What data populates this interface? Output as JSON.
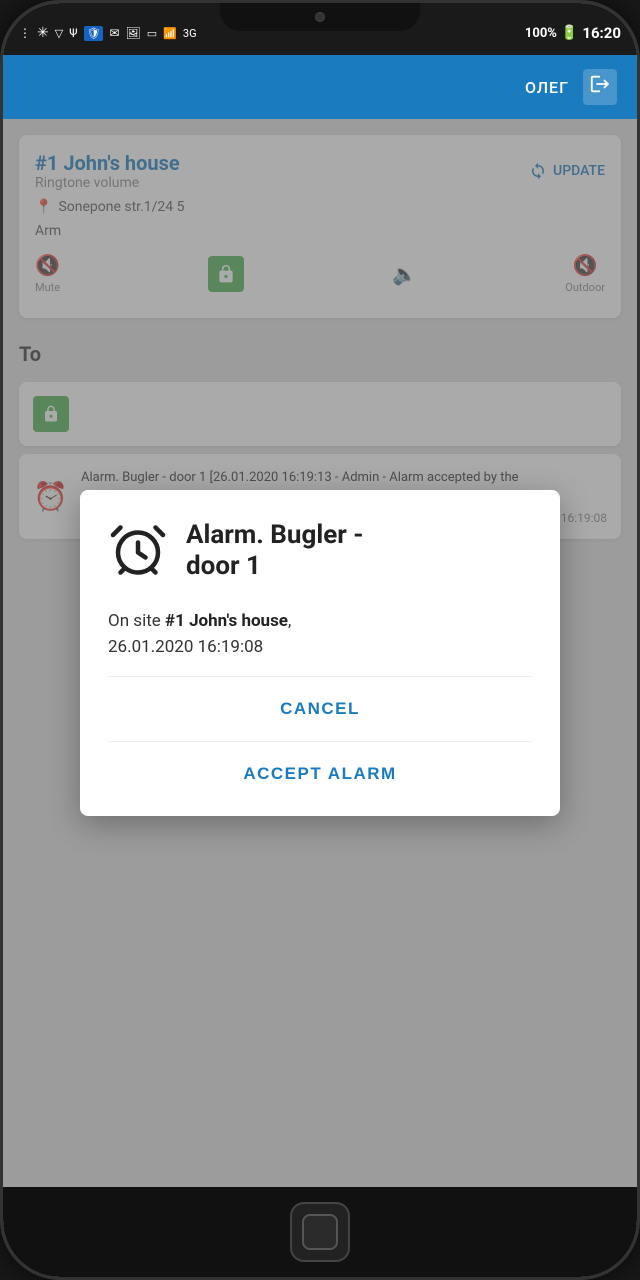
{
  "statusBar": {
    "time": "16:20",
    "battery": "100%",
    "signal": "3G"
  },
  "topBar": {
    "username": "ОЛЕГ",
    "logoutLabel": "→"
  },
  "siteCard": {
    "siteNumber": "#1",
    "siteName": "John's house",
    "subtitle": "Ringtone volume",
    "updateLabel": "UPDATE",
    "address": "Sonepone str.1/24 5",
    "armLabel": "Arm"
  },
  "toolsSection": {
    "title": "To",
    "items": [
      {
        "text": "Alarm. Bugler - door 1 [26.01.2020 16:19:13 - Admin - Alarm accepted by the operator.Реальная тревога]",
        "time": "26.01.2020 16:19:08"
      }
    ]
  },
  "dialog": {
    "title": "Alarm. Bugler -\ndoor 1",
    "bodyText": "On site ",
    "bodyBold": "#1 John's house",
    "bodyDate": ",\n26.01.2020 16:19:08",
    "cancelLabel": "CANCEL",
    "acceptLabel": "ACCEPT ALARM"
  }
}
